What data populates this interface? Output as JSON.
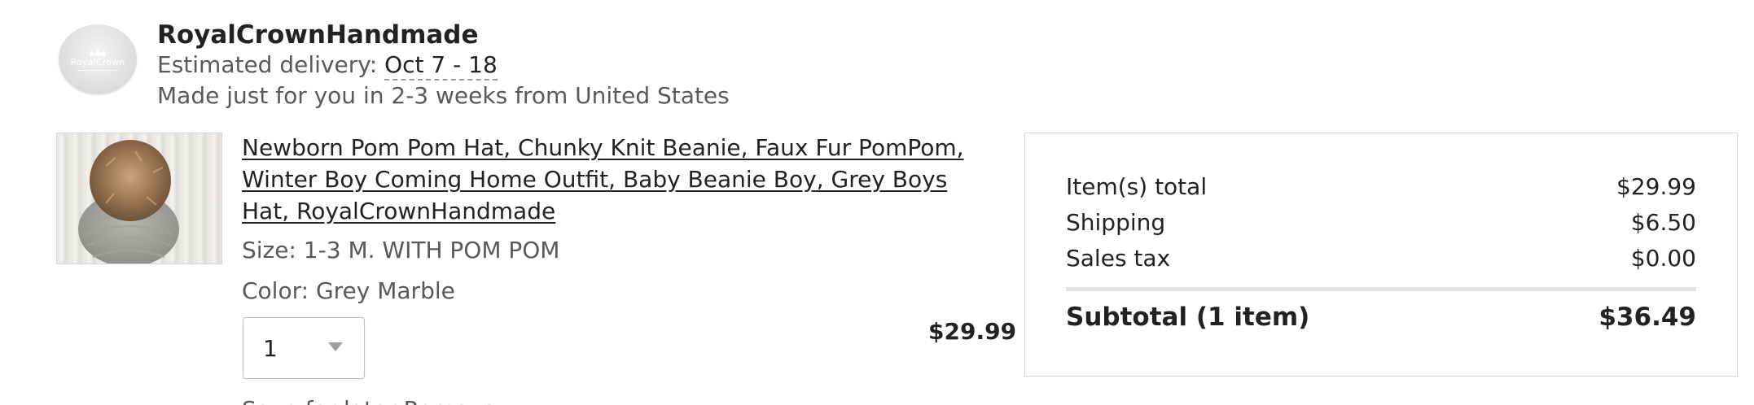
{
  "shop": {
    "name": "RoyalCrownHandmade",
    "avatar_text": "RoyalCrown",
    "delivery_label": "Estimated delivery: ",
    "delivery_dates": "Oct 7 - 18",
    "made_for_you": "Made just for you in 2-3 weeks from United States"
  },
  "listing": {
    "title": "Newborn Pom Pom Hat, Chunky Knit Beanie, Faux Fur PomPom, Winter Boy Coming Home Outfit, Baby Beanie Boy, Grey Boys Hat, RoyalCrownHandmade",
    "size": "Size: 1-3 M. WITH POM POM",
    "color": "Color: Grey Marble",
    "quantity": "1",
    "price": "$29.99",
    "cut_off_text": "Save for later    Remove"
  },
  "summary": {
    "items_total_label": "Item(s) total",
    "items_total_value": "$29.99",
    "shipping_label": "Shipping",
    "shipping_value": "$6.50",
    "tax_label": "Sales tax",
    "tax_value": "$0.00",
    "subtotal_label": "Subtotal (1 item)",
    "subtotal_value": "$36.49"
  },
  "colors": {
    "text_primary": "#222222",
    "text_secondary": "#595959",
    "border": "#d6d6d6",
    "divider": "#e1e1e1"
  },
  "icons": {
    "quantity_dropdown": "chevron-down-icon",
    "avatar_crown": "crown-icon"
  }
}
